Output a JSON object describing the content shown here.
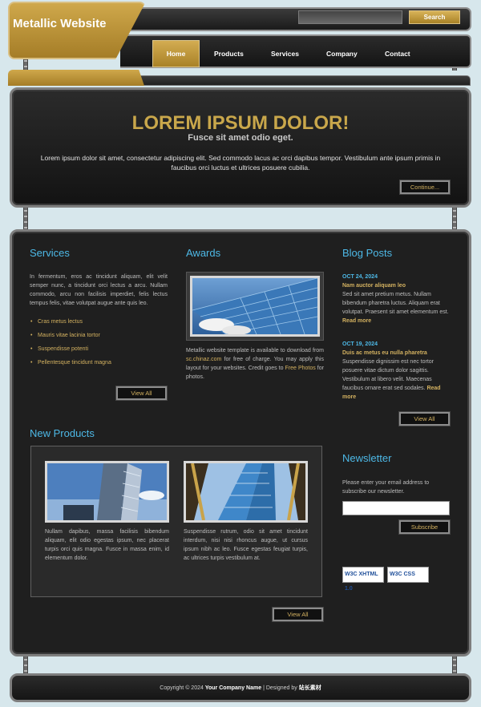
{
  "header": {
    "logo": "Metallic Website",
    "search_placeholder": "",
    "search_button": "Search",
    "nav": [
      "Home",
      "Products",
      "Services",
      "Company",
      "Contact"
    ]
  },
  "hero": {
    "title": "LOREM IPSUM DOLOR!",
    "subtitle": "Fusce sit amet odio eget.",
    "text": "Lorem ipsum dolor sit amet, consectetur adipiscing elit. Sed commodo lacus ac orci dapibus tempor. Vestibulum ante ipsum primis in faucibus orci luctus et ultrices posuere cubilia.",
    "button": "Continue..."
  },
  "services": {
    "title": "Services",
    "text": "In fermentum, eros ac tincidunt aliquam, elit velit semper nunc, a tincidunt orci lectus a arcu. Nullam commodo, arcu non facilisis imperdiet, felis lectus tempus felis, vitae volutpat augue ante quis leo.",
    "items": [
      "Cras metus lectus",
      "Mauris vitae lacinia tortor",
      "Suspendisse potenti",
      "Pellentesque tincidunt magna"
    ],
    "button": "View All"
  },
  "awards": {
    "title": "Awards",
    "text_1": "Metallic website template is available to download from",
    "link_1": "sc.chinaz.com",
    "text_2": "for free of charge. You may apply this layout for your websites. Credit goes to",
    "link_2": "Free Photos",
    "text_3": "for photos."
  },
  "blog": {
    "title": "Blog Posts",
    "posts": [
      {
        "date": "OCT 24, 2024",
        "heading": "Nam auctor aliquam leo",
        "text": "Sed sit amet pretium metus. Nullam bibendum pharetra luctus. Aliquam erat volutpat. Praesent sit amet elementum est.",
        "more": "Read more"
      },
      {
        "date": "OCT 19, 2024",
        "heading": "Duis ac metus eu nulla pharetra",
        "text": "Suspendisse dignissim est nec tortor posuere vitae dictum dolor sagittis. Vestibulum at libero velit. Maecenas faucibus ornare erat sed sodales.",
        "more": "Read more"
      }
    ],
    "button": "View All"
  },
  "products": {
    "title": "New Products",
    "items": [
      {
        "text": "Nullam dapibus, massa facilisis bibendum aliquam, elit odio egestas ipsum, nec placerat turpis orci quis magna. Fusce in massa enim, id elementum dolor."
      },
      {
        "text": "Suspendisse rutrum, odio sit amet tincidunt interdum, nisi nisi rhoncus augue, ut cursus ipsum nibh ac leo. Fusce egestas feugiat turpis, ac ultrices turpis vestibulum at."
      }
    ],
    "button": "View All"
  },
  "newsletter": {
    "title": "Newsletter",
    "text": "Please enter your email address to subscribe our newsletter.",
    "button": "Subscribe",
    "badges": [
      "W3C XHTML 1.0",
      "W3C CSS"
    ]
  },
  "footer": {
    "prefix": "Copyright © 2024",
    "company": "Your Company Name",
    "separator": "| Designed by",
    "designer": "站长素材"
  }
}
